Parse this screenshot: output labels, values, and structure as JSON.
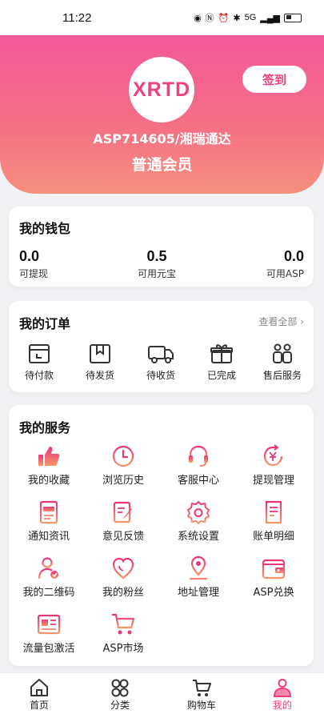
{
  "status_bar": {
    "time": "11:22",
    "network": "5G"
  },
  "profile": {
    "logo_text": "XRTD",
    "sign_in_label": "签到",
    "account": "ASP714605/湘瑞通达",
    "level": "普通会员"
  },
  "wallet": {
    "title": "我的钱包",
    "items": [
      {
        "value": "0.0",
        "label": "可提现"
      },
      {
        "value": "0.5",
        "label": "可用元宝"
      },
      {
        "value": "0.0",
        "label": "可用ASP"
      }
    ]
  },
  "orders": {
    "title": "我的订单",
    "view_all": "查看全部 ›",
    "items": [
      {
        "label": "待付款",
        "icon": "wallet-pay-icon"
      },
      {
        "label": "待发货",
        "icon": "package-icon"
      },
      {
        "label": "待收货",
        "icon": "truck-icon"
      },
      {
        "label": "已完成",
        "icon": "gift-icon"
      },
      {
        "label": "售后服务",
        "icon": "service-people-icon"
      }
    ]
  },
  "services": {
    "title": "我的服务",
    "items": [
      {
        "label": "我的收藏",
        "icon": "thumbs-up-icon"
      },
      {
        "label": "浏览历史",
        "icon": "clock-icon"
      },
      {
        "label": "客服中心",
        "icon": "headset-icon"
      },
      {
        "label": "提现管理",
        "icon": "yen-withdraw-icon"
      },
      {
        "label": "通知资讯",
        "icon": "news-icon"
      },
      {
        "label": "意见反馈",
        "icon": "edit-icon"
      },
      {
        "label": "系统设置",
        "icon": "gear-icon"
      },
      {
        "label": "账单明细",
        "icon": "bill-icon"
      },
      {
        "label": "我的二维码",
        "icon": "user-qr-icon"
      },
      {
        "label": "我的粉丝",
        "icon": "heart-icon"
      },
      {
        "label": "地址管理",
        "icon": "location-pin-icon"
      },
      {
        "label": "ASP兑换",
        "icon": "wallet-exchange-icon"
      },
      {
        "label": "流量包激活",
        "icon": "id-card-icon"
      },
      {
        "label": "ASP市场",
        "icon": "cart-icon"
      }
    ]
  },
  "tabbar": {
    "items": [
      {
        "label": "首页",
        "icon": "home-icon",
        "active": false
      },
      {
        "label": "分类",
        "icon": "category-icon",
        "active": false
      },
      {
        "label": "购物车",
        "icon": "cart-icon",
        "active": false
      },
      {
        "label": "我的",
        "icon": "user-icon",
        "active": true
      }
    ]
  },
  "colors": {
    "accent": "#ee3f7e",
    "gradient_start": "#f3579a",
    "gradient_end": "#f78f7e"
  }
}
